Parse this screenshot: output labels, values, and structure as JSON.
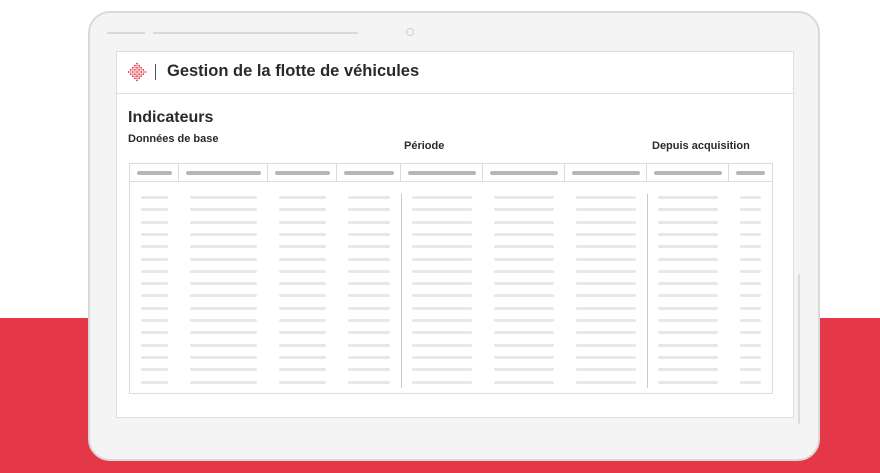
{
  "colors": {
    "accent_red": "#e43747",
    "logo_red": "#e0323f",
    "placeholder_header": "#b6b6b6",
    "placeholder_body": "#e8e8e8",
    "border": "#dcdcdc"
  },
  "app": {
    "logo_icon": "diamond-logo-icon",
    "title": "Gestion de la flotte de véhicules"
  },
  "section": {
    "title": "Indicateurs"
  },
  "column_groups": {
    "base": "Données de base",
    "period": "Période",
    "since_acquisition": "Depuis acquisition"
  },
  "table": {
    "column_count": 9,
    "row_count": 16
  }
}
